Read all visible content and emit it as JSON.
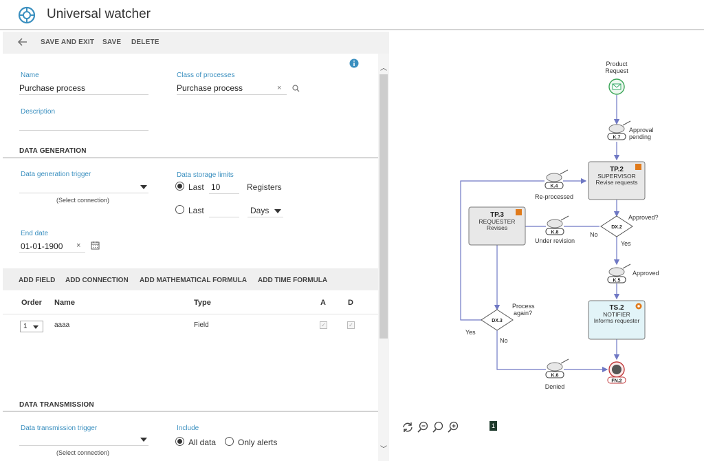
{
  "app": {
    "title": "Universal watcher"
  },
  "toolbar": {
    "save_exit": "SAVE AND EXIT",
    "save": "SAVE",
    "delete": "DELETE"
  },
  "form": {
    "name_label": "Name",
    "name_value": "Purchase process",
    "class_label": "Class of processes",
    "class_value": "Purchase process",
    "description_label": "Description",
    "description_value": ""
  },
  "data_generation": {
    "section_title": "DATA GENERATION",
    "trigger_label": "Data generation trigger",
    "trigger_hint": "(Select connection)",
    "storage_label": "Data storage limits",
    "option1_label": "Last",
    "option1_value": "10",
    "option1_unit": "Registers",
    "option2_label": "Last",
    "option2_value": "",
    "option2_unit": "Days",
    "end_date_label": "End date",
    "end_date_value": "01-01-1900"
  },
  "add_bar": {
    "add_field": "ADD FIELD",
    "add_connection": "ADD CONNECTION",
    "add_math": "ADD MATHEMATICAL FORMULA",
    "add_time": "ADD TIME FORMULA"
  },
  "table": {
    "headers": {
      "order": "Order",
      "name": "Name",
      "type": "Type",
      "a": "A",
      "d": "D"
    },
    "rows": [
      {
        "order": "1",
        "name": "aaaa",
        "type": "Field"
      }
    ]
  },
  "data_transmission": {
    "section_title": "DATA TRANSMISSION",
    "trigger_label": "Data transmission trigger",
    "trigger_hint": "(Select connection)",
    "include_label": "Include",
    "opt_all": "All data",
    "opt_alerts": "Only alerts"
  },
  "diagram": {
    "start_label_1": "Product",
    "start_label_2": "Request",
    "k7": "K.7",
    "k7_label_1": "Approval",
    "k7_label_2": "pending",
    "tp2_code": "TP.2",
    "tp2_role": "SUPERVISOR",
    "tp2_task": "Revise requests",
    "k4": "K.4",
    "k4_label": "Re-processed",
    "dx2": "DX.2",
    "dx2_label": "Approved?",
    "dx2_no": "No",
    "dx2_yes": "Yes",
    "tp3_code": "TP.3",
    "tp3_role": "REQUESTER",
    "tp3_task": "Revises",
    "k8": "K.8",
    "k8_label": "Under revision",
    "k5": "K.5",
    "k5_label": "Approved",
    "dx3": "DX.3",
    "dx3_label_1": "Process",
    "dx3_label_2": "again?",
    "dx3_yes": "Yes",
    "dx3_no": "No",
    "ts2_code": "TS.2",
    "ts2_role": "NOTIFIER",
    "ts2_task": "Informs requester",
    "k6": "K.6",
    "k6_label": "Denied",
    "fn2": "FN.2"
  },
  "page_indicator": "1",
  "icons": [
    "logo-icon",
    "back-arrow-icon",
    "info-icon",
    "clear-icon",
    "search-icon",
    "calendar-icon",
    "refresh-icon",
    "zoom-out-icon",
    "zoom-fit-icon",
    "zoom-in-icon"
  ],
  "colors": {
    "accent": "#3a8fbf",
    "task_fill": "#e8e8e8",
    "service_fill": "#e2f4f8",
    "flow": "#6f78c4"
  }
}
